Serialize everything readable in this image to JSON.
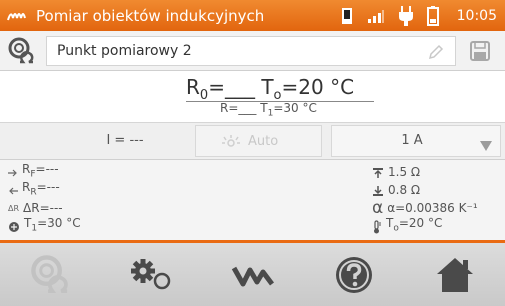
{
  "status_bar": {
    "title": "Pomiar obiektów indukcyjnych",
    "time": "10:05",
    "icons": [
      "sd-card-icon",
      "signal-icon",
      "plug-icon",
      "battery-icon"
    ]
  },
  "point": {
    "name": "Punkt pomiarowy 2"
  },
  "reading": {
    "r0_symbol": "R",
    "r0_sub": "0",
    "r0_value": "=___",
    "t0_symbol": "T",
    "t0_sub": "o",
    "t0_value": "=20 °C",
    "r_text": "R=___",
    "t1_symbol": "T",
    "t1_sub": "1",
    "t1_value": "=30 °C"
  },
  "current": {
    "label": "I = ---",
    "auto_label": "Auto",
    "range_value": "1 A"
  },
  "params": {
    "rf_symbol": "R",
    "rf_sub": "F",
    "rf_value": "=---",
    "rr_symbol": "R",
    "rr_sub": "R",
    "rr_value": "=---",
    "dr_prefix": "ΔR",
    "dr_value": "ΔR=---",
    "t1_symbol": "T",
    "t1_sub": "1",
    "t1_value": "=30 °C",
    "upper_limit": "1.5 Ω",
    "lower_limit": "0.8 Ω",
    "alpha_text": "α=0.00386 K⁻¹",
    "t0_symbol": "T",
    "t0_sub": "o",
    "t0_value": "=20 °C"
  },
  "colors": {
    "accent": "#e96a12",
    "icon": "#4a4a4a"
  }
}
